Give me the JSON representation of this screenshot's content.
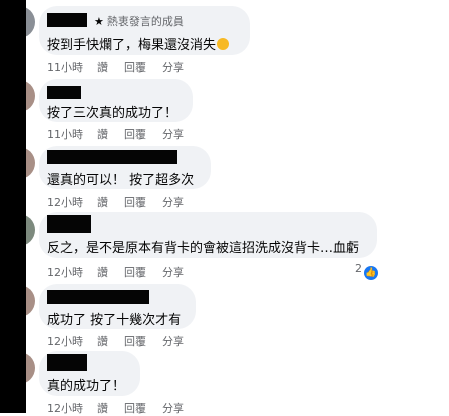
{
  "comments": [
    {
      "badge": "熱衷發言的成員",
      "text": "按到手快爛了，梅果還沒消失",
      "time": "11小時",
      "read": "讚",
      "reply": "回覆",
      "share": "分享"
    },
    {
      "text": "按了三次真的成功了！",
      "time": "11小時",
      "read": "讚",
      "reply": "回覆",
      "share": "分享"
    },
    {
      "text": "還真的可以！ 按了超多次",
      "time": "12小時",
      "read": "讚",
      "reply": "回覆",
      "share": "分享"
    },
    {
      "text": "反之，是不是原本有背卡的會被這招洗成沒背卡…血虧",
      "time": "12小時",
      "read": "讚",
      "reply": "回覆",
      "share": "分享",
      "reactions": "2"
    },
    {
      "text": "成功了 按了十幾次才有",
      "time": "12小時",
      "read": "讚",
      "reply": "回覆",
      "share": "分享"
    },
    {
      "text": "真的成功了！",
      "time": "12小時",
      "read": "讚",
      "reply": "回覆",
      "share": "分享"
    }
  ],
  "colors": {
    "bubble": "#f0f2f5",
    "meta": "#65676b",
    "like": "#1877f2",
    "redaction": "#000000"
  },
  "icons": {
    "badge": "star-icon",
    "emoji": "grimace-emoji-icon",
    "reaction": "like-icon"
  }
}
